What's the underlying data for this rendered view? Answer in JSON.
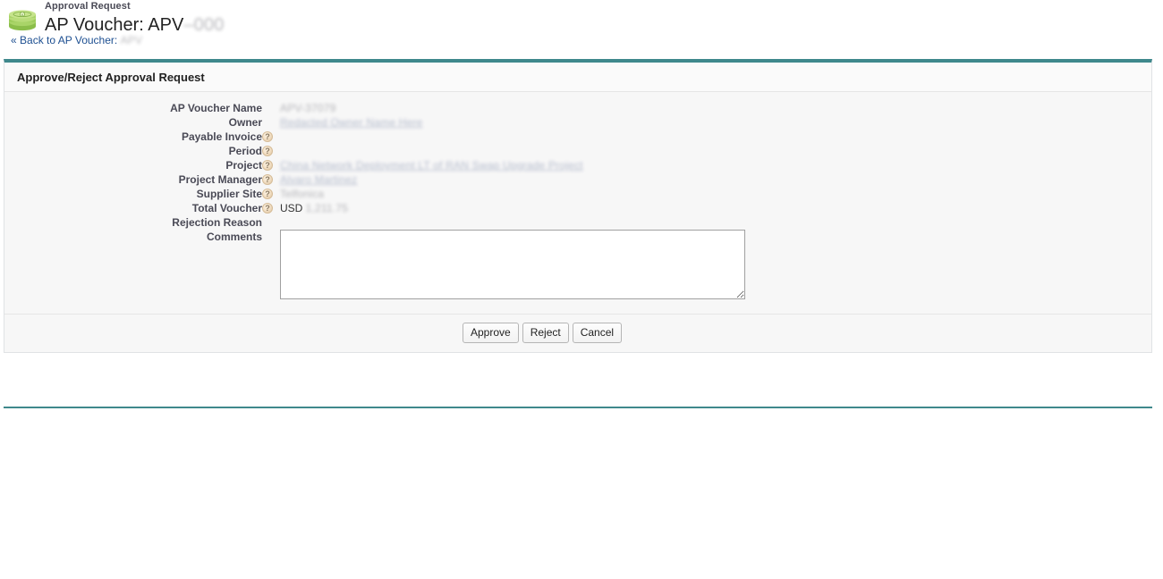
{
  "header": {
    "icon": "money-stack-icon",
    "eyebrow": "Approval Request",
    "title_prefix": "AP Voucher: APV",
    "title_redacted": "–000",
    "back_chevrons": "«",
    "back_link_prefix": "Back to AP Voucher: ",
    "back_link_redacted": "APV"
  },
  "panel": {
    "title": "Approve/Reject Approval Request"
  },
  "fields": [
    {
      "label": "AP Voucher Name",
      "help": false,
      "value_prefix": "",
      "value_redacted": "APV-37079",
      "is_link": false
    },
    {
      "label": "Owner",
      "help": false,
      "value_prefix": "",
      "value_redacted": "Redacted Owner Name Here",
      "is_link": true
    },
    {
      "label": "Payable Invoice",
      "help": true,
      "value_prefix": "",
      "value_redacted": "",
      "is_link": false
    },
    {
      "label": "Period",
      "help": true,
      "value_prefix": "",
      "value_redacted": "",
      "is_link": false
    },
    {
      "label": "Project",
      "help": true,
      "value_prefix": "",
      "value_redacted": "China Network Deployment LT of RAN Swap Upgrade Project",
      "is_link": true
    },
    {
      "label": "Project Manager",
      "help": true,
      "value_prefix": "",
      "value_redacted": "Alvaro Martinez",
      "is_link": true
    },
    {
      "label": "Supplier Site",
      "help": true,
      "value_prefix": "",
      "value_redacted": "Telfonica",
      "is_link": false
    },
    {
      "label": "Total Voucher",
      "help": true,
      "value_prefix": "USD ",
      "value_redacted": "1,211.75",
      "is_link": false
    },
    {
      "label": "Rejection Reason",
      "help": false,
      "value_prefix": "",
      "value_redacted": "",
      "is_link": false
    }
  ],
  "comments": {
    "label": "Comments",
    "value": "",
    "placeholder": ""
  },
  "buttons": [
    {
      "label": "Approve",
      "name": "approve-button"
    },
    {
      "label": "Reject",
      "name": "reject-button"
    },
    {
      "label": "Cancel",
      "name": "cancel-button"
    }
  ],
  "colors": {
    "accent_teal": "#3f888c",
    "link_blue": "#1d4f91",
    "label_gray": "#4a4a56",
    "panel_bg": "#f7f7f7",
    "help_icon_tan": "#f0dcc0"
  }
}
